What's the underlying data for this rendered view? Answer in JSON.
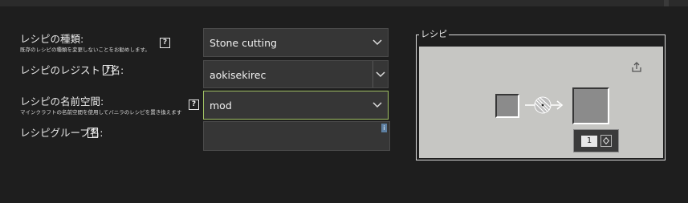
{
  "form": {
    "recipe_type": {
      "label": "レシピの種類:",
      "sub": "既存のレシピの種類を変更しないことをお勧めします。",
      "help": "?",
      "value": "Stone cutting"
    },
    "registry_name": {
      "label": "レシピのレジストリ名:",
      "help": "?",
      "value": "aokisekirec"
    },
    "namespace": {
      "label": "レシピの名前空間:",
      "sub": "マインクラフトの名前空間を使用してバニラのレシピを置き換えます",
      "help": "?",
      "value": "mod"
    },
    "group": {
      "label": "レシピグループ名:",
      "help": "?",
      "value": "",
      "resize_glyph": "i"
    }
  },
  "recipe_panel": {
    "legend": "レシピ",
    "output_count": "1",
    "icons": {
      "export": "export-icon",
      "arrow": "stonecutter-saw-arrow-icon",
      "spinner": "spinner-icon"
    }
  },
  "colors": {
    "background": "#1e1e1e",
    "field_bg": "#363636",
    "focus_border": "#9fbf63",
    "panel_bg": "#c6c6c3",
    "slot_bg": "#8b8b8b"
  }
}
